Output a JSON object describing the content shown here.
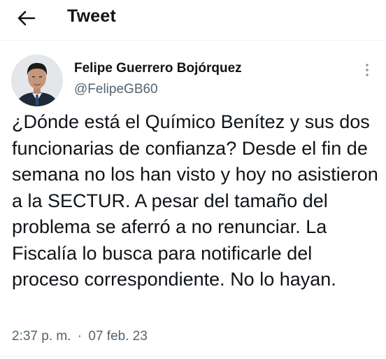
{
  "header": {
    "title": "Tweet",
    "back_icon": "arrow-left-icon"
  },
  "tweet": {
    "author_name": "Felipe Guerrero Bojórquez",
    "author_handle": "@FelipeGB60",
    "more_icon": "more-vertical-icon",
    "text": "¿Dónde está el Químico Benítez y sus dos funcionarias de confianza? Desde el fin de semana no los han visto y hoy no asistieron a la SECTUR. A pesar del tamaño del problema se aferró a no renunciar. La Fiscalía lo busca para notificarle del proceso correspondiente. No lo hayan.",
    "time": "2:37 p. m.",
    "separator": "·",
    "date": "07 feb. 23"
  },
  "colors": {
    "text_primary": "#0f1419",
    "text_secondary": "#536471",
    "divider": "#eff3f4"
  }
}
